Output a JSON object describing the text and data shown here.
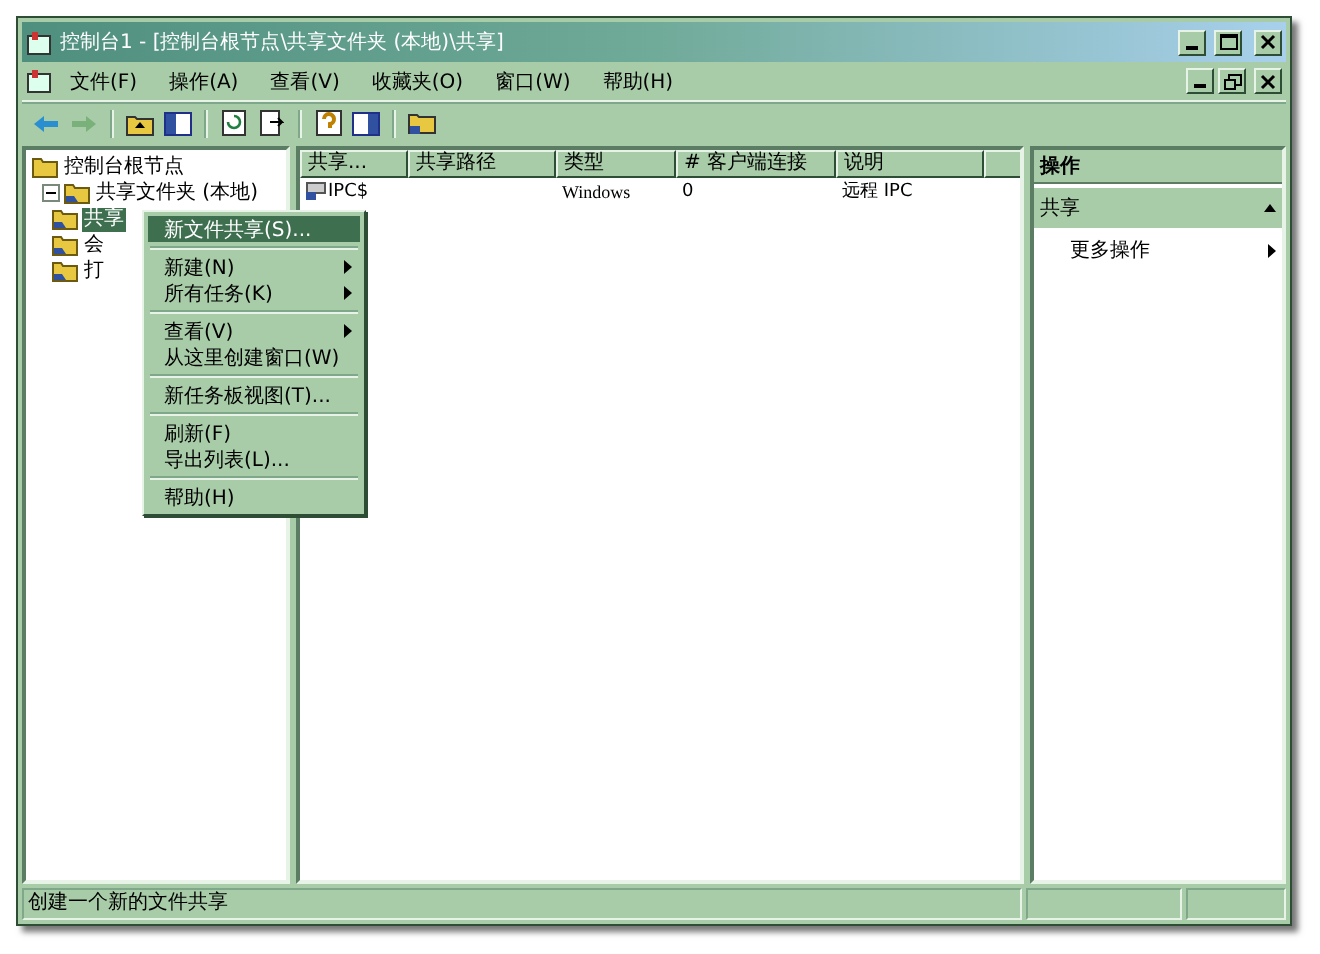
{
  "window": {
    "title": "控制台1 - [控制台根节点\\共享文件夹 (本地)\\共享]"
  },
  "menu_bar": [
    "文件(F)",
    "操作(A)",
    "查看(V)",
    "收藏夹(O)",
    "窗口(W)",
    "帮助(H)"
  ],
  "tree": [
    {
      "label": "控制台根节点",
      "selected": false,
      "children": [
        {
          "label": "共享文件夹 (本地)",
          "expanded": true,
          "selected": false,
          "children": [
            {
              "label": "共享",
              "selected": true
            },
            {
              "label": "会",
              "selected": false
            },
            {
              "label": "打",
              "selected": false
            }
          ]
        }
      ]
    }
  ],
  "table": {
    "columns": [
      "共享...",
      "共享路径",
      "类型",
      "# 客户端连接",
      "说明"
    ],
    "rows": [
      [
        "IPC$",
        "",
        "Windows",
        "0",
        "远程 IPC"
      ]
    ]
  },
  "actions": {
    "title": "操作",
    "sections": [
      {
        "label": "共享",
        "expanded": true,
        "items": [
          {
            "label": "更多操作",
            "submenu": true
          }
        ]
      }
    ]
  },
  "context_menu": [
    {
      "kind": "item",
      "label": "新文件共享(S)...",
      "selected": true,
      "submenu": false
    },
    {
      "kind": "separator"
    },
    {
      "kind": "item",
      "label": "新建(N)",
      "selected": false,
      "submenu": true
    },
    {
      "kind": "item",
      "label": "所有任务(K)",
      "selected": false,
      "submenu": true
    },
    {
      "kind": "separator"
    },
    {
      "kind": "item",
      "label": "查看(V)",
      "selected": false,
      "submenu": true
    },
    {
      "kind": "item",
      "label": "从这里创建窗口(W)",
      "selected": false,
      "submenu": false
    },
    {
      "kind": "separator"
    },
    {
      "kind": "item",
      "label": "新任务板视图(T)...",
      "selected": false,
      "submenu": false
    },
    {
      "kind": "separator"
    },
    {
      "kind": "item",
      "label": "刷新(F)",
      "selected": false,
      "submenu": false
    },
    {
      "kind": "item",
      "label": "导出列表(L)...",
      "selected": false,
      "submenu": false
    },
    {
      "kind": "separator"
    },
    {
      "kind": "item",
      "label": "帮助(H)",
      "selected": false,
      "submenu": false
    }
  ],
  "status_bar": [
    "创建一个新的文件共享"
  ]
}
